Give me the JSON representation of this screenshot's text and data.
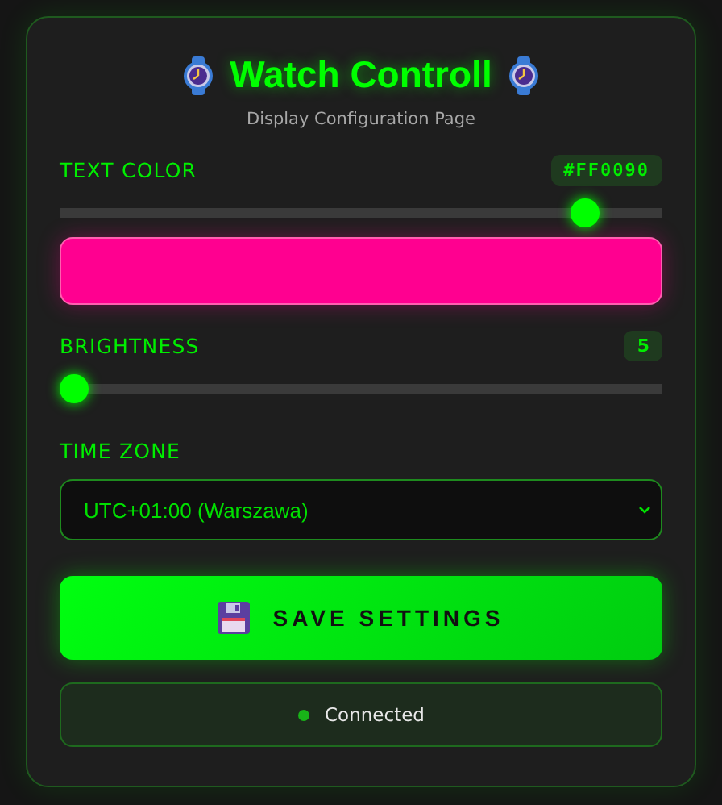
{
  "header": {
    "title": "Watch Controll",
    "subtitle": "Display Configuration Page"
  },
  "text_color": {
    "label": "TEXT COLOR",
    "value": "#FF0090",
    "level": 0.89,
    "swatch": {
      "color": "#ff0090"
    }
  },
  "brightness": {
    "label": "BRIGHTNESS",
    "value": "5",
    "level": 0.0
  },
  "time_zone": {
    "label": "TIME ZONE",
    "value": "UTC+01:00 (Warszawa)"
  },
  "save_button": {
    "label": "SAVE SETTINGS"
  },
  "status": {
    "text": "Connected",
    "connected": true
  }
}
